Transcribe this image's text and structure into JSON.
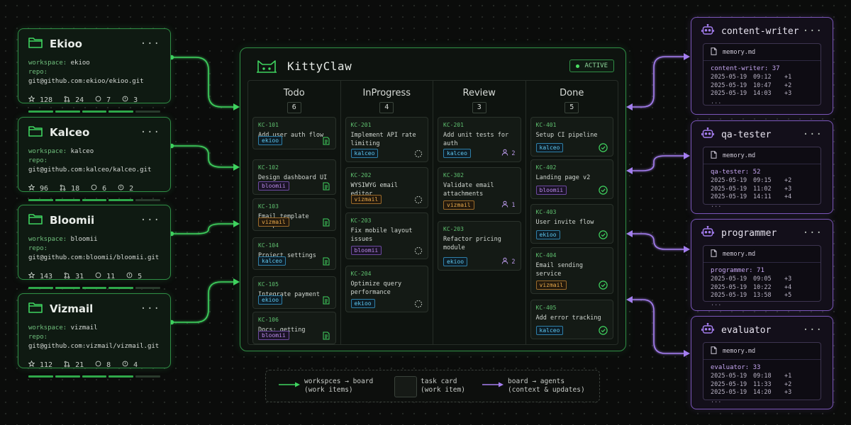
{
  "workspaces": [
    {
      "name": "Ekioo",
      "workspace": "ekioo",
      "repo": "git@github.com:ekioo/ekioo.git",
      "stars": "128",
      "prs": "24",
      "issues": "7",
      "alerts": "3"
    },
    {
      "name": "Kalceo",
      "workspace": "kalceo",
      "repo": "git@github.com:kalceo/kalceo.git",
      "stars": "96",
      "prs": "18",
      "issues": "6",
      "alerts": "2"
    },
    {
      "name": "Bloomii",
      "workspace": "bloomii",
      "repo": "git@github.com:bloomii/bloomii.git",
      "stars": "143",
      "prs": "31",
      "issues": "11",
      "alerts": "5"
    },
    {
      "name": "Vizmail",
      "workspace": "vizmail",
      "repo": "git@github.com:vizmail/vizmail.git",
      "stars": "112",
      "prs": "21",
      "issues": "8",
      "alerts": "4"
    }
  ],
  "labels": {
    "workspace": "workspace:",
    "repo": "repo:",
    "more": "···"
  },
  "board": {
    "title": "KittyClaw",
    "status": "ACTIVE",
    "columns": [
      {
        "title": "Todo",
        "count": "6",
        "tasks": [
          {
            "id": "KC-101",
            "title": "Add user auth flow",
            "tag": "ekioo"
          },
          {
            "id": "KC-102",
            "title": "Design dashboard UI",
            "tag": "bloomii"
          },
          {
            "id": "KC-103",
            "title": "Email template setup",
            "tag": "vizmail"
          },
          {
            "id": "KC-104",
            "title": "Project settings API",
            "tag": "kalceo"
          },
          {
            "id": "KC-105",
            "title": "Integrate payment",
            "tag": "ekioo"
          },
          {
            "id": "KC-106",
            "title": "Docs: getting started",
            "tag": "bloomii"
          }
        ]
      },
      {
        "title": "InProgress",
        "count": "4",
        "tasks": [
          {
            "id": "KC-201",
            "title": "Implement API rate limiting",
            "tag": "kalceo"
          },
          {
            "id": "KC-202",
            "title": "WYSIWYG email editor",
            "tag": "vizmail"
          },
          {
            "id": "KC-203",
            "title": "Fix mobile layout issues",
            "tag": "bloomii"
          },
          {
            "id": "KC-204",
            "title": "Optimize query performance",
            "tag": "ekioo"
          }
        ]
      },
      {
        "title": "Review",
        "count": "3",
        "tasks": [
          {
            "id": "KC-201",
            "title": "Add unit tests for auth",
            "tag": "kalceo",
            "assignees": "2"
          },
          {
            "id": "KC-302",
            "title": "Validate email attachments",
            "tag": "vizmail",
            "assignees": "1"
          },
          {
            "id": "KC-203",
            "title": "Refactor pricing module",
            "tag": "ekioo",
            "assignees": "2"
          }
        ]
      },
      {
        "title": "Done",
        "count": "5",
        "tasks": [
          {
            "id": "KC-401",
            "title": "Setup CI pipeline",
            "tag": "kalceo"
          },
          {
            "id": "KC-402",
            "title": "Landing page v2",
            "tag": "bloomii"
          },
          {
            "id": "KC-403",
            "title": "User invite flow",
            "tag": "ekioo"
          },
          {
            "id": "KC-404",
            "title": "Email sending service",
            "tag": "vizmail"
          },
          {
            "id": "KC-405",
            "title": "Add error tracking",
            "tag": "kalceo"
          }
        ]
      }
    ]
  },
  "agents": [
    {
      "name": "content-writer",
      "file": "memory.md",
      "count_line": "content-writer: 37",
      "rows": [
        [
          "2025-05-19",
          "09:12",
          "+1"
        ],
        [
          "2025-05-19",
          "10:47",
          "+2"
        ],
        [
          "2025-05-19",
          "14:03",
          "+3"
        ]
      ]
    },
    {
      "name": "qa-tester",
      "file": "memory.md",
      "count_line": "qa-tester: 52",
      "rows": [
        [
          "2025-05-19",
          "09:15",
          "+2"
        ],
        [
          "2025-05-19",
          "11:02",
          "+3"
        ],
        [
          "2025-05-19",
          "14:11",
          "+4"
        ]
      ]
    },
    {
      "name": "programmer",
      "file": "memory.md",
      "count_line": "programmer: 71",
      "rows": [
        [
          "2025-05-19",
          "09:05",
          "+3"
        ],
        [
          "2025-05-19",
          "10:22",
          "+4"
        ],
        [
          "2025-05-19",
          "13:58",
          "+5"
        ]
      ]
    },
    {
      "name": "evaluator",
      "file": "memory.md",
      "count_line": "evaluator: 33",
      "rows": [
        [
          "2025-05-19",
          "09:18",
          "+1"
        ],
        [
          "2025-05-19",
          "11:33",
          "+2"
        ],
        [
          "2025-05-19",
          "14:20",
          "+3"
        ]
      ]
    }
  ],
  "ellipsis": "...",
  "legend": {
    "green_line1": "workspces → board",
    "green_line2": "(work items)",
    "card_line1": "task card",
    "card_line2": "(work item)",
    "purple_line1": "board → agents",
    "purple_line2": "(context & updates)"
  },
  "colors": {
    "green": "#3fd35f",
    "purple": "#a57ef0",
    "cyan_tag": "#5fc7ee",
    "purple_tag": "#b98ae8",
    "orange_tag": "#e8a94a"
  }
}
